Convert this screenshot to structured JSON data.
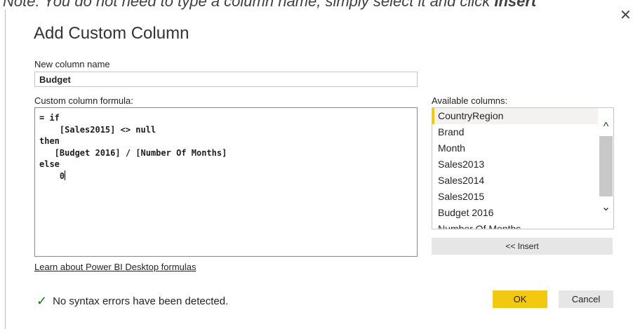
{
  "note": {
    "text": "Note: You do not need to type a column name, simply select it and click ",
    "emphasis": "Insert"
  },
  "dialog": {
    "title": "Add Custom Column",
    "close_icon": "close-icon"
  },
  "new_column": {
    "label": "New column name",
    "value": "Budget"
  },
  "formula": {
    "label": "Custom column formula:",
    "lines": [
      "= if",
      "    [Sales2015] <> null",
      "then",
      "   [Budget 2016] / [Number Of Months]",
      "else",
      "    0"
    ]
  },
  "available_columns": {
    "label": "Available columns:",
    "items": [
      "CountryRegion",
      "Brand",
      "Month",
      "Sales2013",
      "Sales2014",
      "Sales2015",
      "Budget 2016",
      "Number Of Months"
    ],
    "selected_index": 0,
    "insert_label": "<< Insert"
  },
  "learn_link": "Learn about Power BI Desktop formulas",
  "status": {
    "icon": "checkmark-icon",
    "text": "No syntax errors have been detected."
  },
  "buttons": {
    "ok": "OK",
    "cancel": "Cancel"
  },
  "colors": {
    "accent": "#f2c811",
    "check": "#107c10"
  }
}
